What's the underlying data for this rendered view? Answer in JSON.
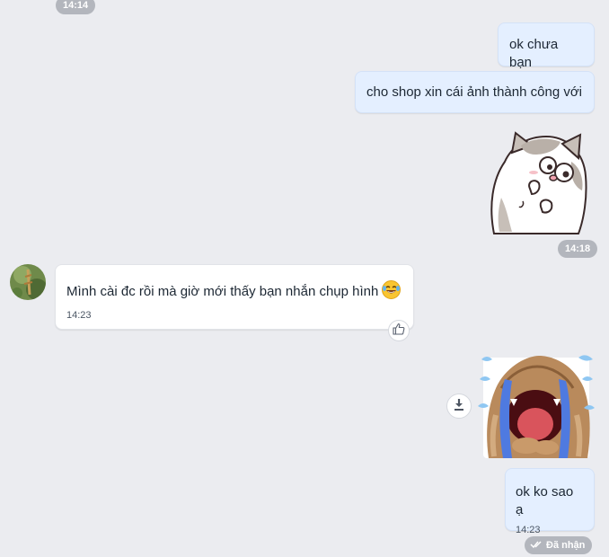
{
  "conversation": {
    "top_time": "14:14",
    "messages": [
      {
        "text": "ok chưa bạn"
      },
      {
        "text": "cho shop xin cái ảnh thành công với"
      }
    ],
    "sticker_cat_time": "14:18",
    "incoming": {
      "text": "Mình cài đc rồi mà giờ mới thấy bạn nhắn chụp hình",
      "time": "14:23",
      "emoji": "laughing-tears-emoji"
    },
    "last_message": {
      "text": "ok ko sao ạ",
      "time": "14:23"
    },
    "status": "Đã nhận"
  },
  "icons": {
    "like": "thumbs-up-icon",
    "download": "download-icon",
    "delivered": "double-check-icon"
  },
  "colors": {
    "background": "#ebecf0",
    "outgoing_bubble": "#e4efff",
    "incoming_bubble": "#ffffff",
    "time_pill": "#b3b6bd"
  }
}
